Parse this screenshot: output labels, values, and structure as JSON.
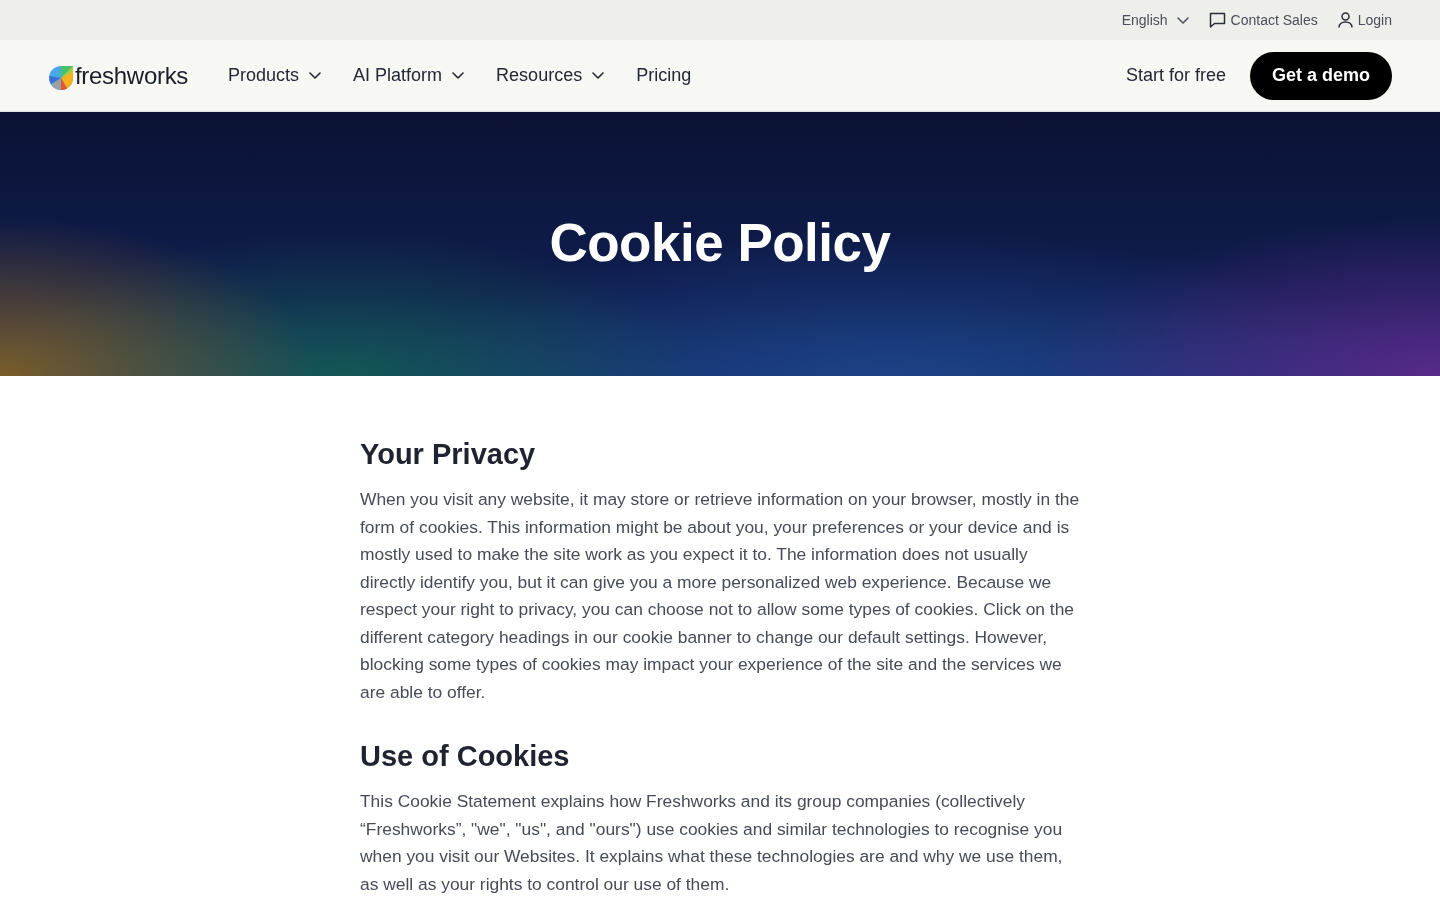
{
  "top_bar": {
    "language": "English",
    "links": [
      {
        "kind": "chat",
        "label": "Contact Sales"
      },
      {
        "kind": "user",
        "label": "Login"
      }
    ]
  },
  "nav": {
    "logo": "freshworks",
    "items": [
      {
        "label": "Products",
        "has_menu": true
      },
      {
        "label": "AI Platform",
        "has_menu": true
      },
      {
        "label": "Resources",
        "has_menu": true
      },
      {
        "label": "Pricing",
        "has_menu": false
      }
    ],
    "start_link": "Start for free",
    "demo_button": "Get a demo"
  },
  "hero": {
    "title": "Cookie Policy"
  },
  "sections": [
    {
      "heading": "Your Privacy",
      "paragraphs": [
        "When you visit any website, it may store or retrieve information on your browser, mostly in the form of cookies. This information might be about you, your preferences or your device and is mostly used to make the site work as you expect it to. The information does not usually directly identify you, but it can give you a more personalized web experience. Because we respect your right to privacy, you can choose not to allow some types of cookies. Click on the different category headings in our cookie banner to change our default settings. However, blocking some types of cookies may impact your experience of the site and the services we are able to offer."
      ]
    },
    {
      "heading": "Use of Cookies",
      "paragraphs": [
        "This Cookie Statement explains how Freshworks and its group companies (collectively “Freshworks”, \"we\", \"us\", and \"ours\") use cookies and similar technologies to recognise you when you visit our Websites. It explains what these technologies are and why we use them, as well as your rights to control our use of them."
      ]
    }
  ]
}
